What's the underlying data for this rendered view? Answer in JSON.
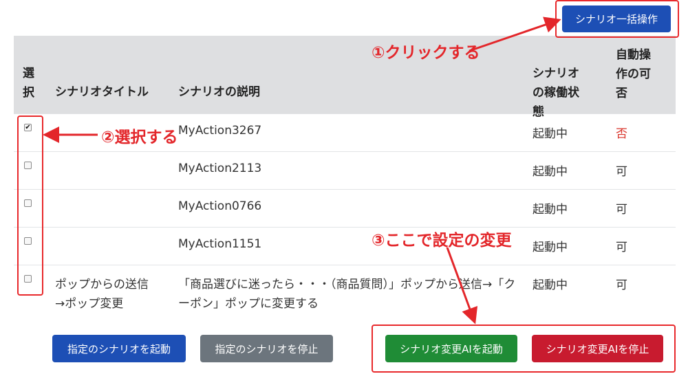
{
  "top_button": "シナリオ一括操作",
  "table": {
    "headers": {
      "select": "選択",
      "title": "シナリオタイトル",
      "description": "シナリオの説明",
      "status": "シナリオの稼働状態",
      "auto": "自動操作の可否"
    },
    "rows": [
      {
        "checked": true,
        "title": "",
        "description": "MyAction3267",
        "status": "起動中",
        "auto": "否"
      },
      {
        "checked": false,
        "title": "",
        "description": "MyAction2113",
        "status": "起動中",
        "auto": "可"
      },
      {
        "checked": false,
        "title": "",
        "description": "MyAction0766",
        "status": "起動中",
        "auto": "可"
      },
      {
        "checked": false,
        "title": "",
        "description": "MyAction1151",
        "status": "起動中",
        "auto": "可"
      },
      {
        "checked": false,
        "title": "ポップからの送信→ポップ変更",
        "description": "「商品選びに迷ったら・・・（商品質問）」ポップから送信→「クーポン」ポップに変更する",
        "status": "起動中",
        "auto": "可"
      }
    ]
  },
  "bottom_buttons": {
    "start_selected": "指定のシナリオを起動",
    "stop_selected": "指定のシナリオを停止",
    "start_ai": "シナリオ変更AIを起動",
    "stop_ai": "シナリオ変更AIを停止"
  },
  "annotations": {
    "click": "①クリックする",
    "select": "②選択する",
    "change": "③ここで設定の変更"
  },
  "colors": {
    "primary": "#1d4fb5",
    "secondary": "#6c757d",
    "success": "#1f8c36",
    "danger": "#c81b2f",
    "annotation": "#e3262a",
    "header_bg": "#dedfe1"
  }
}
